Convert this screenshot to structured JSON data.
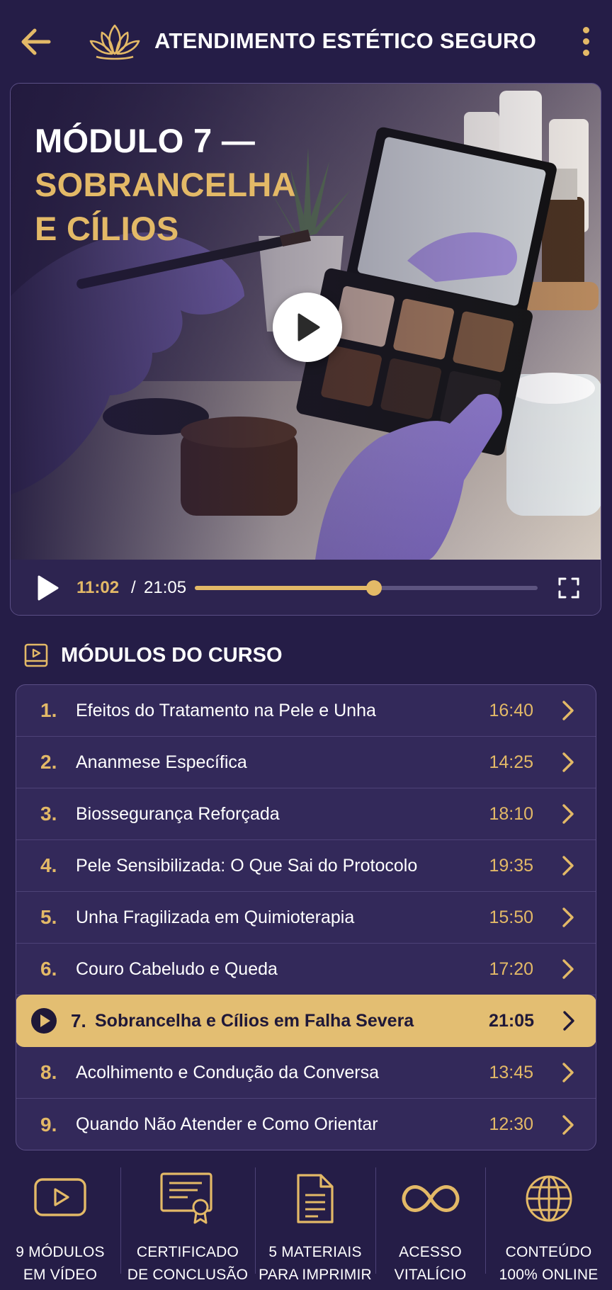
{
  "header": {
    "title": "ATENDIMENTO ESTÉTICO SEGURO",
    "back_icon": "arrow-left-icon",
    "logo_icon": "lotus-icon",
    "menu_icon": "more-vertical-icon"
  },
  "video": {
    "title_line1": "MÓDULO 7 —",
    "title_line2": "SOBRANCELHA",
    "title_line3": "E CÍLIOS",
    "current_time": "11:02",
    "separator": "/",
    "total_time": "21:05",
    "progress": 0.523
  },
  "modules": {
    "heading": "MÓDULOS DO CURSO",
    "items": [
      {
        "num": "1.",
        "title": "Efeitos do Tratamento na Pele e Unha",
        "duration": "16:40",
        "active": false
      },
      {
        "num": "2.",
        "title": "Ananmese Específica",
        "duration": "14:25",
        "active": false
      },
      {
        "num": "3.",
        "title": "Biossegurança Reforçada",
        "duration": "18:10",
        "active": false
      },
      {
        "num": "4.",
        "title": "Pele Sensibilizada: O Que Sai do Protocolo",
        "duration": "19:35",
        "active": false
      },
      {
        "num": "5.",
        "title": "Unha Fragilizada em Quimioterapia",
        "duration": "15:50",
        "active": false
      },
      {
        "num": "6.",
        "title": "Couro Cabeludo e Queda",
        "duration": "17:20",
        "active": false
      },
      {
        "num": "7.",
        "title": "Sobrancelha e Cílios em Falha Severa",
        "duration": "21:05",
        "active": true
      },
      {
        "num": "8.",
        "title": "Acolhimento e Condução da Conversa",
        "duration": "13:45",
        "active": false
      },
      {
        "num": "9.",
        "title": "Quando Não Atender e Como Orientar",
        "duration": "12:30",
        "active": false
      }
    ]
  },
  "features": [
    {
      "line1": "9 MÓDULOS",
      "line2": "EM VÍDEO",
      "icon": "video-play-icon"
    },
    {
      "line1": "CERTIFICADO",
      "line2": "DE CONCLUSÃO",
      "icon": "certificate-icon"
    },
    {
      "line1": "5 MATERIAIS",
      "line2": "PARA IMPRIMIR",
      "icon": "document-icon"
    },
    {
      "line1": "ACESSO",
      "line2": "VITALÍCIO",
      "icon": "infinity-icon"
    },
    {
      "line1": "CONTEÚDO",
      "line2": "100% ONLINE",
      "icon": "globe-icon"
    }
  ],
  "colors": {
    "background": "#251d47",
    "accent": "#e3b967",
    "active_row": "#e3be72",
    "glove": "#9b86d6"
  }
}
